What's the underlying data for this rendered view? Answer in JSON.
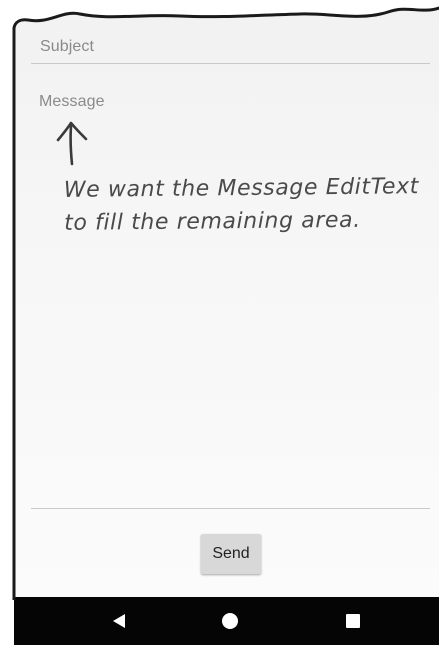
{
  "form": {
    "subject_placeholder": "Subject",
    "message_placeholder": "Message",
    "send_label": "Send"
  },
  "annotation": {
    "line1": "We want the Message EditText",
    "line2": "to fill the remaining area."
  },
  "nav_bar": {
    "back_icon": "back-triangle-icon",
    "home_icon": "home-circle-icon",
    "recents_icon": "recents-square-icon"
  },
  "colors": {
    "nav_bar": "#050505",
    "button": "#d8d8d8",
    "hint_text": "#8a8a8a"
  }
}
